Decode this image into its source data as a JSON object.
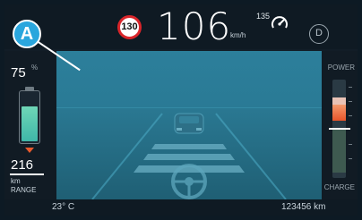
{
  "header": {
    "speed_limit": "130",
    "speed": "106",
    "speed_unit": "km/h",
    "cruise_speed": "135",
    "gear": "D"
  },
  "marker": {
    "label": "A"
  },
  "battery": {
    "percent": "75",
    "percent_symbol": "%",
    "level": 0.75,
    "range_value": "216",
    "range_unit": "km",
    "range_label": "RANGE"
  },
  "power_meter": {
    "power_label": "POWER",
    "charge_label": "CHARGE"
  },
  "footer": {
    "temperature": "23° C",
    "odometer": "123456 km"
  },
  "icons": [
    "cruise-control-icon",
    "battery-icon",
    "range-arrow-icon",
    "car-icon",
    "steering-wheel-icon"
  ],
  "colors": {
    "accent": "#2aa6dd",
    "speed_limit_ring": "#d9252a",
    "battery": "#5fcbb1",
    "power": "#e8542a"
  }
}
